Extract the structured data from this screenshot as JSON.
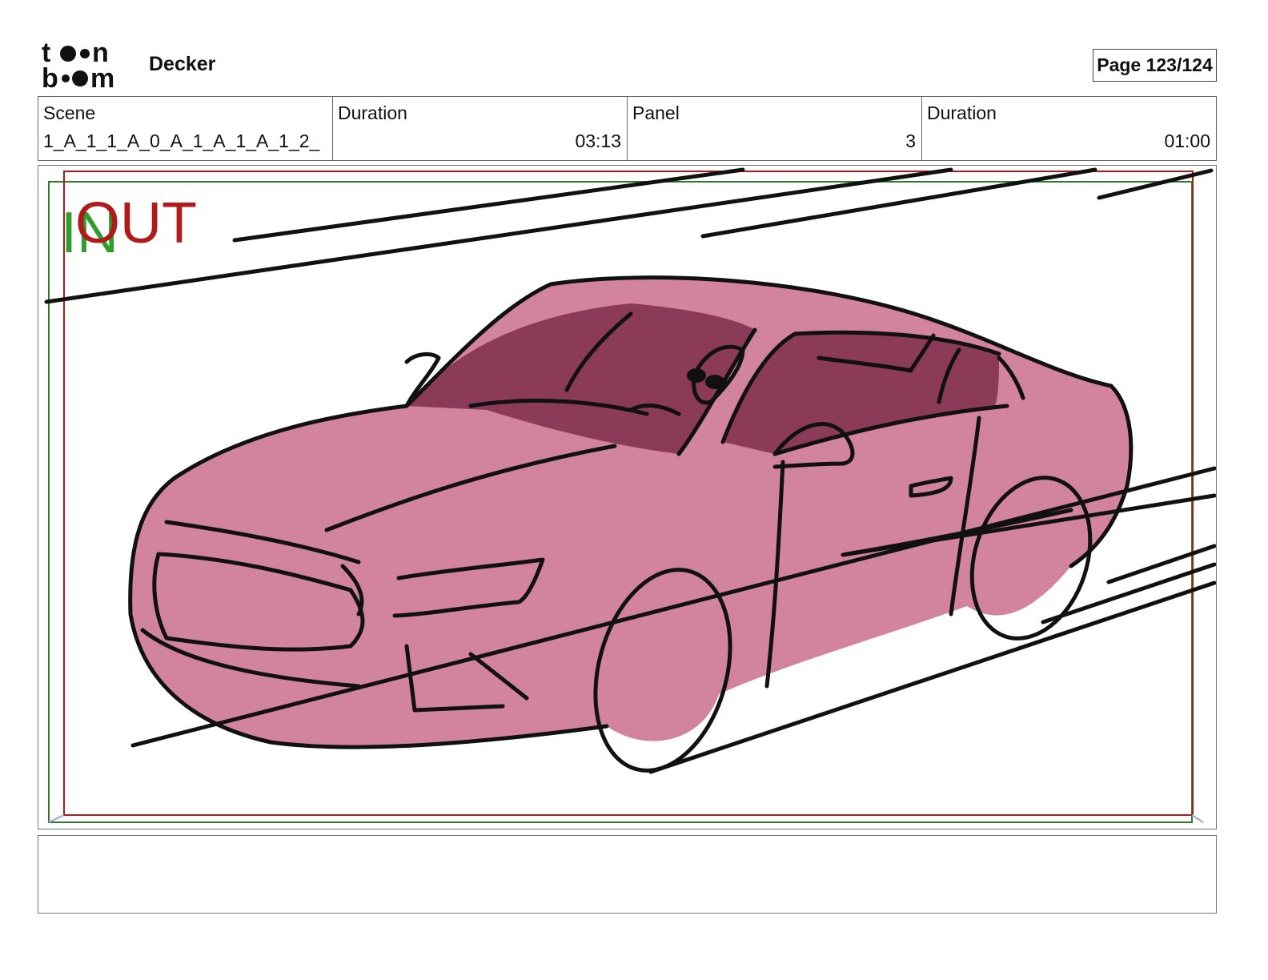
{
  "header": {
    "logo_text": "toon boom",
    "app_name": "Decker",
    "page_label": "Page 123/124"
  },
  "info": {
    "scene_label": "Scene",
    "scene_value": "1_A_1_1_A_0_A_1_A_1_A_1_2_",
    "duration_label": "Duration",
    "duration_value": "03:13",
    "panel_label": "Panel",
    "panel_value": "3",
    "panel_duration_label": "Duration",
    "panel_duration_value": "01:00"
  },
  "panel": {
    "in_label": "IN",
    "out_label": "OUT",
    "in_color": "#2e9d2e",
    "out_color": "#b01a1a",
    "car_fill": "#d2849c",
    "window_fill": "#8b3b57",
    "drawing": "car-sketch"
  },
  "notes": {
    "text": ""
  }
}
